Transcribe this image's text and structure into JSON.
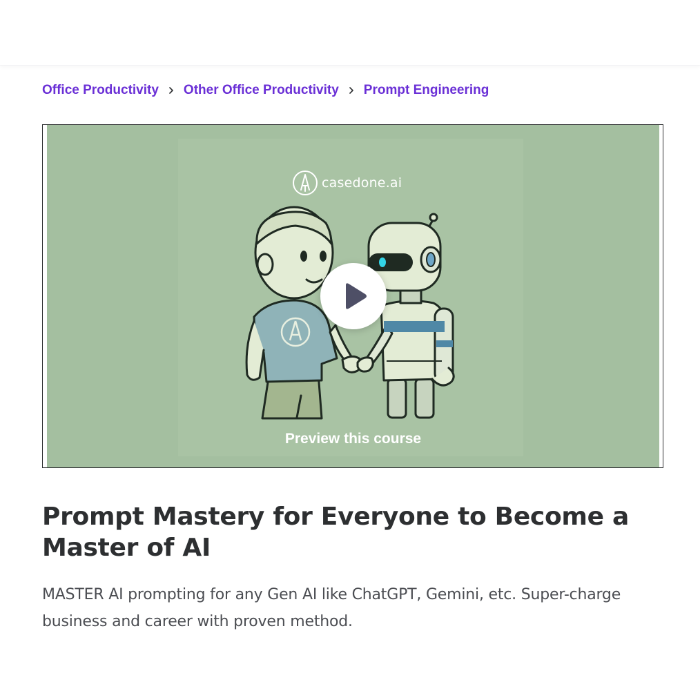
{
  "breadcrumb": {
    "items": [
      {
        "label": "Office Productivity"
      },
      {
        "label": "Other Office Productivity"
      },
      {
        "label": "Prompt Engineering"
      }
    ]
  },
  "preview": {
    "brand_name": "casedone.ai",
    "label": "Preview this course",
    "icons": {
      "play": "play-icon",
      "brand": "rocket-logo-icon"
    },
    "colors": {
      "background": "#a4bfa0",
      "label": "#ffffff"
    }
  },
  "course": {
    "title": "Prompt Mastery for Everyone to Become a Master of AI",
    "subtitle": "MASTER AI prompting for any Gen AI like ChatGPT, Gemini, etc. Super-charge business and career with proven method."
  },
  "colors": {
    "link": "#6a2fd6",
    "text": "#2d2f31"
  }
}
